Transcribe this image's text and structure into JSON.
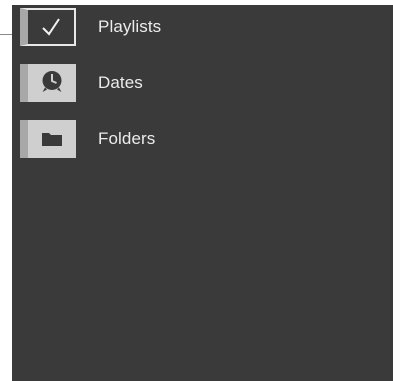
{
  "menu": {
    "items": [
      {
        "label": "Playlists",
        "icon": "checkmark-icon",
        "selected": true
      },
      {
        "label": "Dates",
        "icon": "clock-icon",
        "selected": false
      },
      {
        "label": "Folders",
        "icon": "folder-icon",
        "selected": false
      }
    ]
  },
  "colors": {
    "panel_bg": "#3a3a3a",
    "tile_bg": "#cfcfcf",
    "tile_edge": "#a8a8a8",
    "text": "#ececec",
    "icon_dark": "#3a3a3a"
  }
}
